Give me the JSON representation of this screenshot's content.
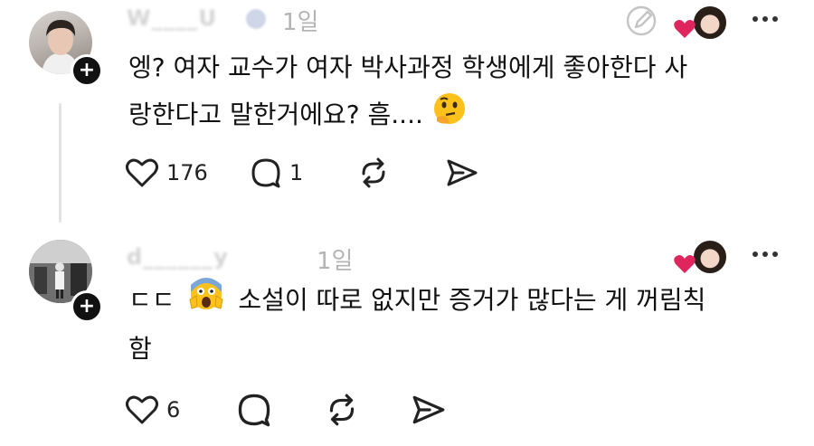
{
  "comments": [
    {
      "username": "W____U",
      "time": "1일",
      "text_line1": "엥? 여자 교수가 여자 박사과정 학생에게 좋아한다  사",
      "text_line2": "랑한다고 말한거에요? 흠....",
      "emoji": "thinking-face",
      "likes": "176",
      "replies": "1"
    },
    {
      "username": "d______y",
      "time": "1일",
      "text_line1_prefix": "ㄷㄷ",
      "emoji": "screaming-face",
      "text_line1": "소설이 따로 없지만 증거가 많다는 게 꺼림칙",
      "text_line2": "함",
      "likes": "6"
    }
  ],
  "colors": {
    "heart": "#e0245e",
    "text": "#111111",
    "muted": "#b4b4b4"
  },
  "icons": [
    "plus-icon",
    "edit-icon",
    "heart-icon",
    "more-icon",
    "like-icon",
    "reply-icon",
    "repost-icon",
    "share-icon"
  ]
}
